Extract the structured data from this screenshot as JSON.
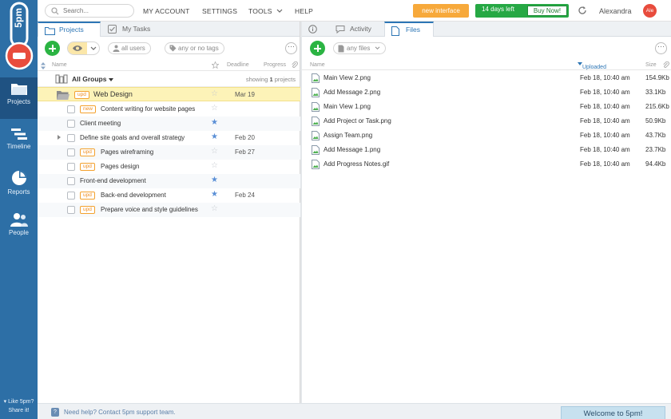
{
  "sidebar": {
    "logo_text": "5pm",
    "items": [
      {
        "label": "Projects",
        "icon": "folder-icon"
      },
      {
        "label": "Timeline",
        "icon": "timeline-icon"
      },
      {
        "label": "Reports",
        "icon": "pie-chart-icon"
      },
      {
        "label": "People",
        "icon": "people-icon"
      }
    ],
    "share_line1": "▾ Like 5pm?",
    "share_line2": "Share it!"
  },
  "topbar": {
    "search_placeholder": "Search...",
    "menu": [
      "MY ACCOUNT",
      "SETTINGS",
      "TOOLS",
      "HELP"
    ],
    "new_interface": "new interface",
    "trial_text": "14 days left",
    "buy_now": "Buy Now!",
    "username": "Alexandra",
    "avatar_initials": "Ale"
  },
  "left": {
    "tabs": [
      "Projects",
      "My Tasks"
    ],
    "filters": {
      "users": "all users",
      "tags": "any or no tags"
    },
    "columns": {
      "name": "Name",
      "deadline": "Deadline",
      "progress": "Progress"
    },
    "groups_label": "All Groups",
    "showing_prefix": "showing",
    "showing_count": "1",
    "showing_suffix": "projects",
    "project": {
      "badge": "upd",
      "name": "Web Design",
      "deadline": "Mar 19"
    },
    "tasks": [
      {
        "badge": "new",
        "name": "Content writing for website pages",
        "starred": false,
        "deadline": ""
      },
      {
        "badge": "",
        "name": "Client meeting",
        "starred": true,
        "deadline": ""
      },
      {
        "badge": "",
        "name": "Define site goals and overall strategy",
        "starred": true,
        "deadline": "Feb 20",
        "expandable": true
      },
      {
        "badge": "upd",
        "name": "Pages wireframing",
        "starred": false,
        "deadline": "Feb 27"
      },
      {
        "badge": "upd",
        "name": "Pages design",
        "starred": false,
        "deadline": ""
      },
      {
        "badge": "",
        "name": "Front-end development",
        "starred": true,
        "deadline": ""
      },
      {
        "badge": "upd",
        "name": "Back-end development",
        "starred": true,
        "deadline": "Feb 24"
      },
      {
        "badge": "upd",
        "name": "Prepare voice and style guidelines",
        "starred": false,
        "deadline": ""
      }
    ]
  },
  "right": {
    "tabs": [
      "",
      "Activity",
      "Files"
    ],
    "filter": "any files",
    "columns": {
      "name": "Name",
      "uploaded": "Uploaded",
      "size": "Size"
    },
    "files": [
      {
        "name": "Main View 2.png",
        "uploaded": "Feb 18, 10:40 am",
        "size": "154.9Kb"
      },
      {
        "name": "Add Message 2.png",
        "uploaded": "Feb 18, 10:40 am",
        "size": "33.1Kb"
      },
      {
        "name": "Main View 1.png",
        "uploaded": "Feb 18, 10:40 am",
        "size": "215.6Kb"
      },
      {
        "name": "Add Project or Task.png",
        "uploaded": "Feb 18, 10:40 am",
        "size": "50.9Kb"
      },
      {
        "name": "Assign Team.png",
        "uploaded": "Feb 18, 10:40 am",
        "size": "43.7Kb"
      },
      {
        "name": "Add Message 1.png",
        "uploaded": "Feb 18, 10:40 am",
        "size": "23.7Kb"
      },
      {
        "name": "Add Progress Notes.gif",
        "uploaded": "Feb 18, 10:40 am",
        "size": "94.4Kb"
      }
    ]
  },
  "bottom": {
    "help": "Need help? Contact 5pm support team.",
    "welcome": "Welcome to 5pm!"
  },
  "colors": {
    "sidebar": "#2d6fa6",
    "accent_green": "#2bb443",
    "accent_orange": "#f7a93b",
    "link_blue": "#2d76b5",
    "project_highlight": "#fdf3b8"
  }
}
